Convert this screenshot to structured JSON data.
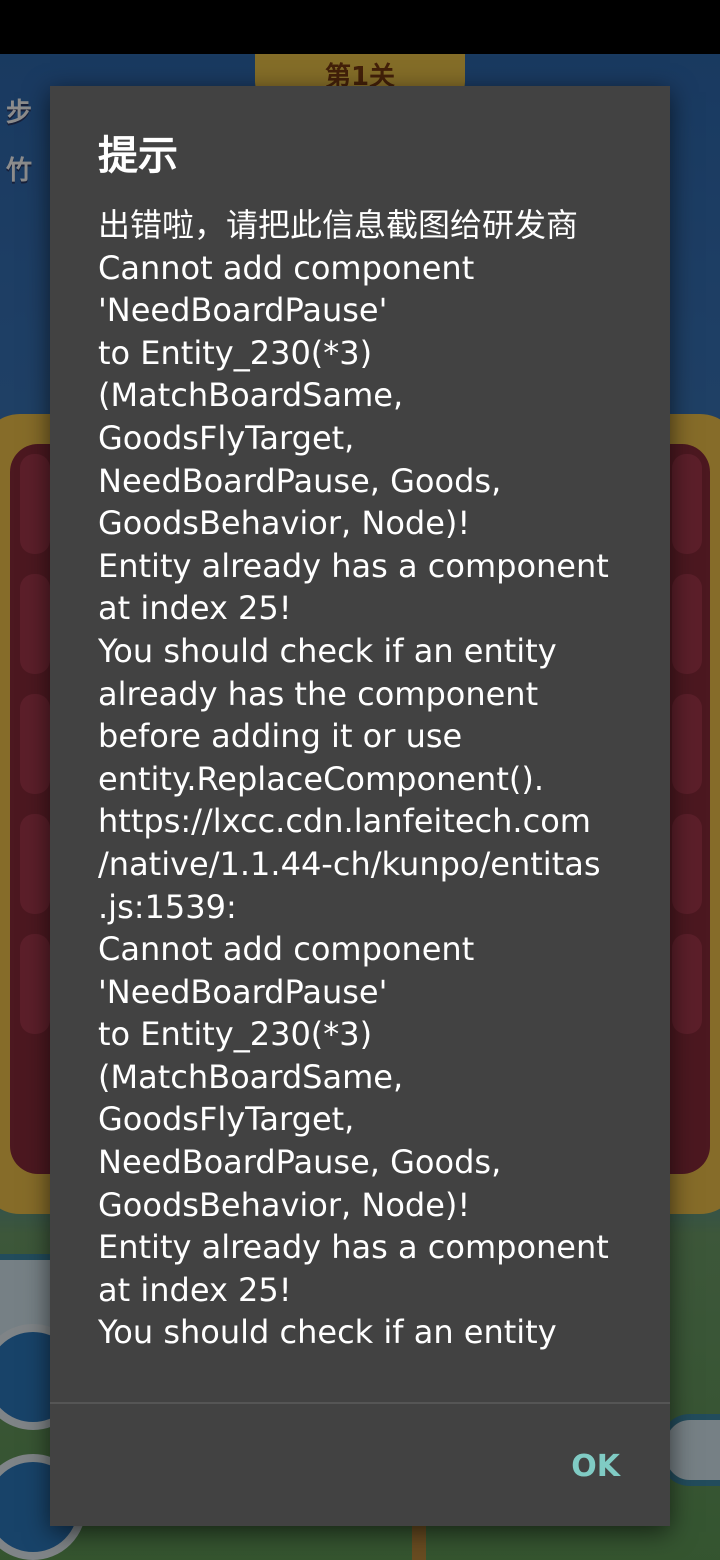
{
  "background": {
    "level_label": "第1关",
    "left_stats": [
      "步",
      "竹"
    ]
  },
  "dialog": {
    "title": "提示",
    "message": "出错啦，请把此信息截图给研发商\nCannot add component\n'NeedBoardPause'\nto Entity_230(*3)\n(MatchBoardSame,\nGoodsFlyTarget,\nNeedBoardPause, Goods,\nGoodsBehavior, Node)!\nEntity already has a component\nat index 25!\nYou should check if an entity\nalready has the component\nbefore adding it or use\nentity.ReplaceComponent().\nhttps://lxcc.cdn.lanfeitech.com\n/native/1.1.44-ch/kunpo/entitas\n.js:1539:\nCannot add component\n'NeedBoardPause'\nto Entity_230(*3)\n(MatchBoardSame,\nGoodsFlyTarget,\nNeedBoardPause, Goods,\nGoodsBehavior, Node)!\nEntity already has a component\nat index 25!\nYou should check if an entity",
    "ok_label": "OK",
    "ok_color": "#80cbc4",
    "background_color": "#424242"
  }
}
